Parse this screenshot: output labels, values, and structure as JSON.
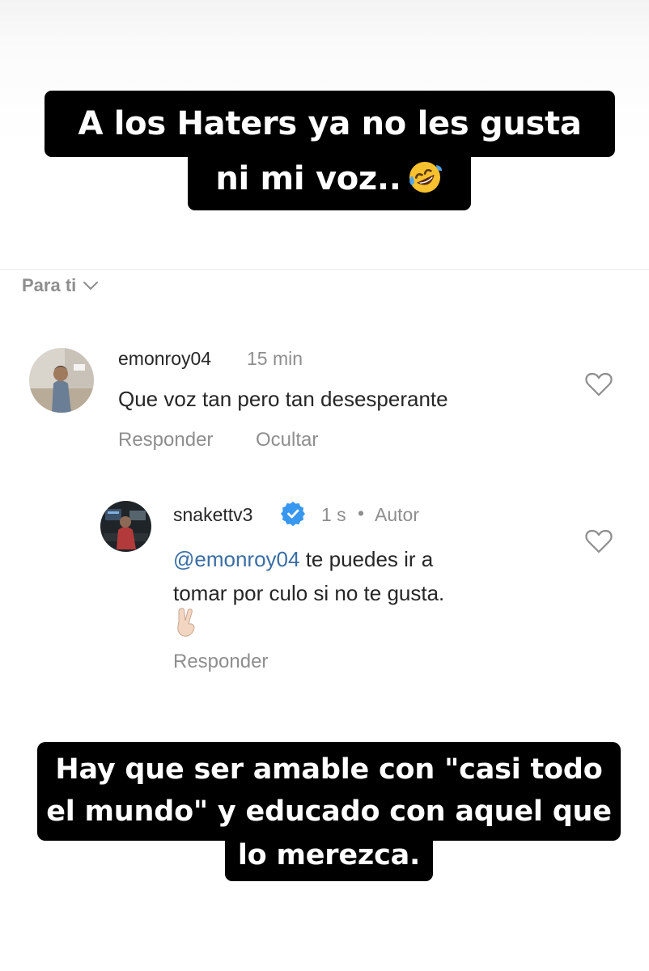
{
  "top_caption": {
    "line1": "A los Haters ya no les gusta",
    "line2": "ni mi voz..",
    "emoji": "rolling-on-floor-laughing"
  },
  "filter": {
    "label": "Para ti",
    "icon": "chevron-down-icon"
  },
  "comments": [
    {
      "username": "emonroy04",
      "time": "15 min",
      "text": "Que voz tan pero tan desesperante",
      "actions": [
        "Responder",
        "Ocultar"
      ]
    }
  ],
  "reply": {
    "username": "snakettv3",
    "verified": true,
    "time": "1 s",
    "separator": "•",
    "role": "Autor",
    "mention": "@emonroy04",
    "text_line1": " te puedes ir a",
    "text_line2": "tomar por culo si no te gusta.",
    "emoji": "victory-hand",
    "action": "Responder"
  },
  "bottom_caption": {
    "line1": "Hay que ser amable  con \"casi todo",
    "line2": "el mundo\" y educado con aquel que",
    "line3": "lo merezca."
  },
  "colors": {
    "caption_bg": "#000000",
    "caption_text": "#ffffff",
    "mention": "#3a6ea5",
    "verified": "#3897f0",
    "muted": "#8e8e8e",
    "text": "#262626"
  }
}
